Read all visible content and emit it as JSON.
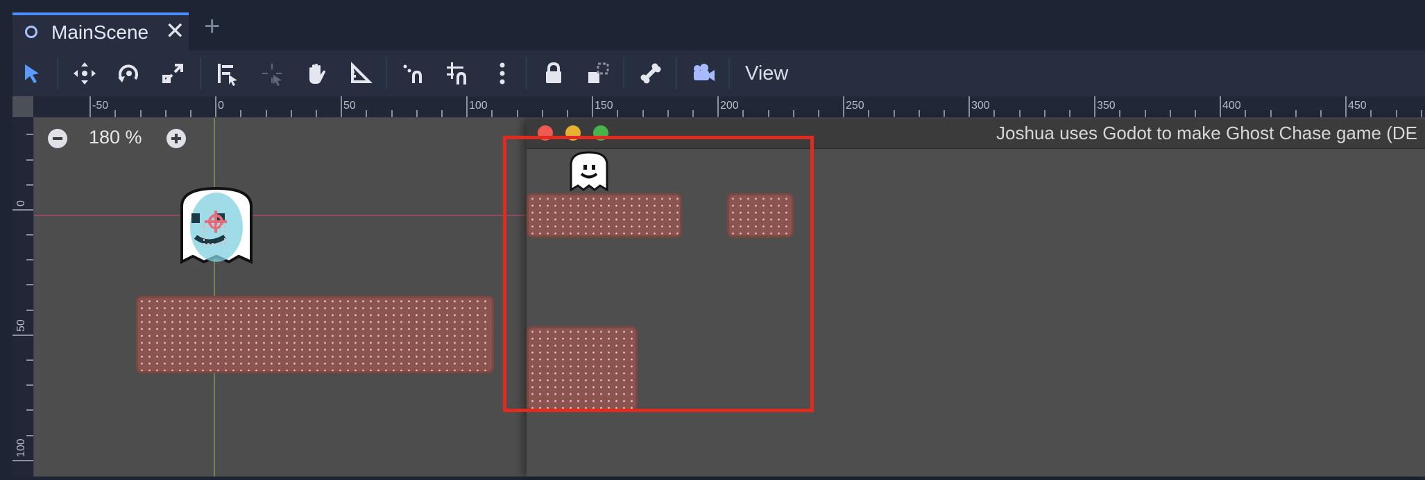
{
  "tab": {
    "title": "MainScene",
    "icon": "scene-circle-icon",
    "close": "✕",
    "add": "+"
  },
  "toolbar": {
    "tools": [
      "select-arrow-icon",
      "move-icon",
      "rotate-icon",
      "scale-icon",
      "list-select-icon",
      "pivot-icon",
      "pan-hand-icon",
      "ruler-icon",
      "smart-snap-icon",
      "grid-snap-icon",
      "more-vertical-icon",
      "lock-icon",
      "group-icon",
      "bone-icon",
      "camera-icon"
    ],
    "view_label": "View"
  },
  "ruler": {
    "top_labels": [
      "-50",
      "0",
      "50",
      "100",
      "150",
      "200",
      "250",
      "300",
      "350",
      "400",
      "450"
    ],
    "left_labels": [
      "0",
      "50",
      "100"
    ]
  },
  "zoom": {
    "level": "180 %"
  },
  "game_window": {
    "title": "Joshua uses Godot to make Ghost Chase game (DE"
  },
  "colors": {
    "accent": "#4f8cff",
    "highlight": "#df2b22",
    "platform": "#8b5450"
  }
}
